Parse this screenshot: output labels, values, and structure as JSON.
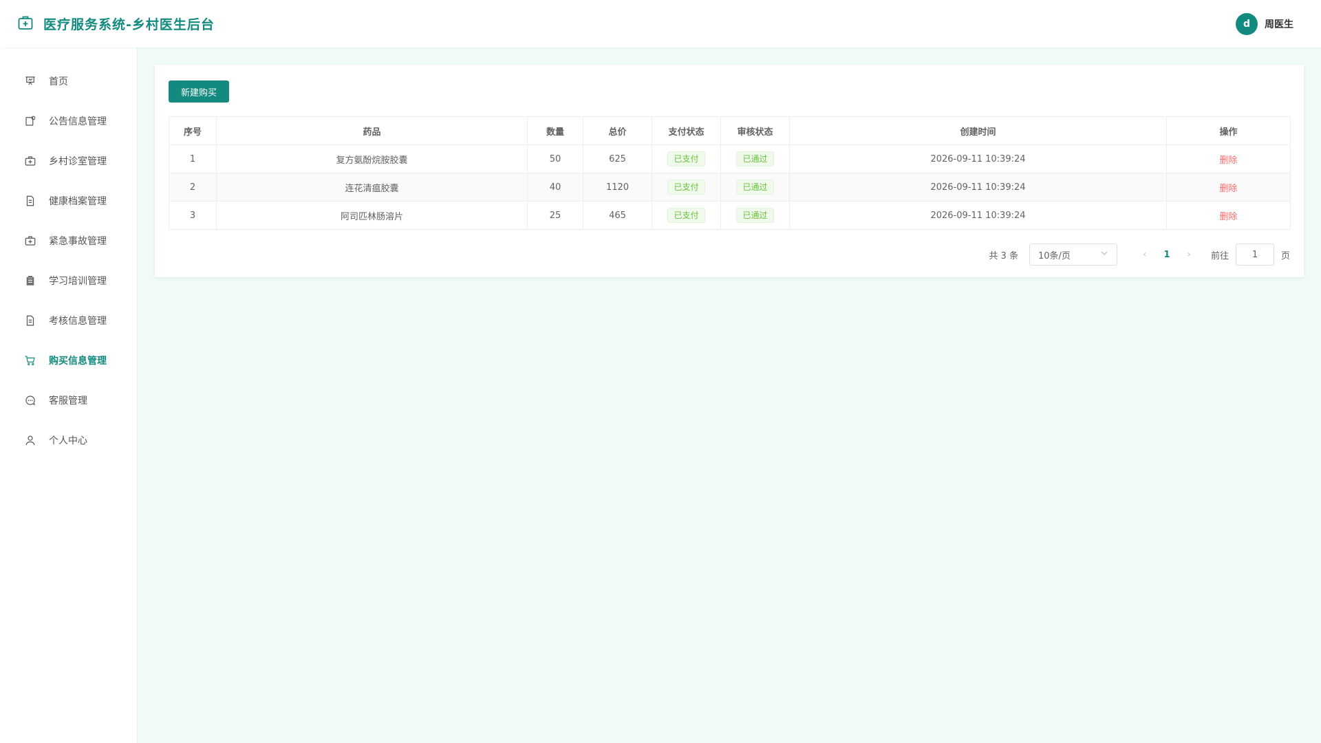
{
  "header": {
    "title": "医疗服务系统-乡村医生后台",
    "avatar_letter": "d",
    "username": "周医生"
  },
  "sidebar": {
    "items": [
      {
        "label": "首页",
        "icon": "presentation-icon"
      },
      {
        "label": "公告信息管理",
        "icon": "notice-icon"
      },
      {
        "label": "乡村诊室管理",
        "icon": "medical-kit-icon"
      },
      {
        "label": "健康档案管理",
        "icon": "document-icon"
      },
      {
        "label": "紧急事故管理",
        "icon": "first-aid-icon"
      },
      {
        "label": "学习培训管理",
        "icon": "clipboard-icon"
      },
      {
        "label": "考核信息管理",
        "icon": "document-icon"
      },
      {
        "label": "购买信息管理",
        "icon": "cart-icon",
        "active": true
      },
      {
        "label": "客服管理",
        "icon": "chat-icon"
      },
      {
        "label": "个人中心",
        "icon": "user-icon"
      }
    ]
  },
  "toolbar": {
    "new_label": "新建购买"
  },
  "table": {
    "headers": [
      "序号",
      "药品",
      "数量",
      "总价",
      "支付状态",
      "审核状态",
      "创建时间",
      "操作"
    ],
    "rows": [
      {
        "no": "1",
        "drug": "复方氨酚烷胺胶囊",
        "qty": "50",
        "total": "625",
        "pay": "已支付",
        "audit": "已通过",
        "created": "2026-09-11 10:39:24",
        "action": "删除"
      },
      {
        "no": "2",
        "drug": "连花清瘟胶囊",
        "qty": "40",
        "total": "1120",
        "pay": "已支付",
        "audit": "已通过",
        "created": "2026-09-11 10:39:24",
        "action": "删除"
      },
      {
        "no": "3",
        "drug": "阿司匹林肠溶片",
        "qty": "25",
        "total": "465",
        "pay": "已支付",
        "audit": "已通过",
        "created": "2026-09-11 10:39:24",
        "action": "删除"
      }
    ]
  },
  "pagination": {
    "total_text": "共 3 条",
    "page_size": "10条/页",
    "current_page": "1",
    "goto_label": "前往",
    "goto_value": "1",
    "page_suffix": "页"
  },
  "colors": {
    "brand": "#138a7f",
    "danger": "#f56c6c",
    "success": "#67c23a"
  }
}
